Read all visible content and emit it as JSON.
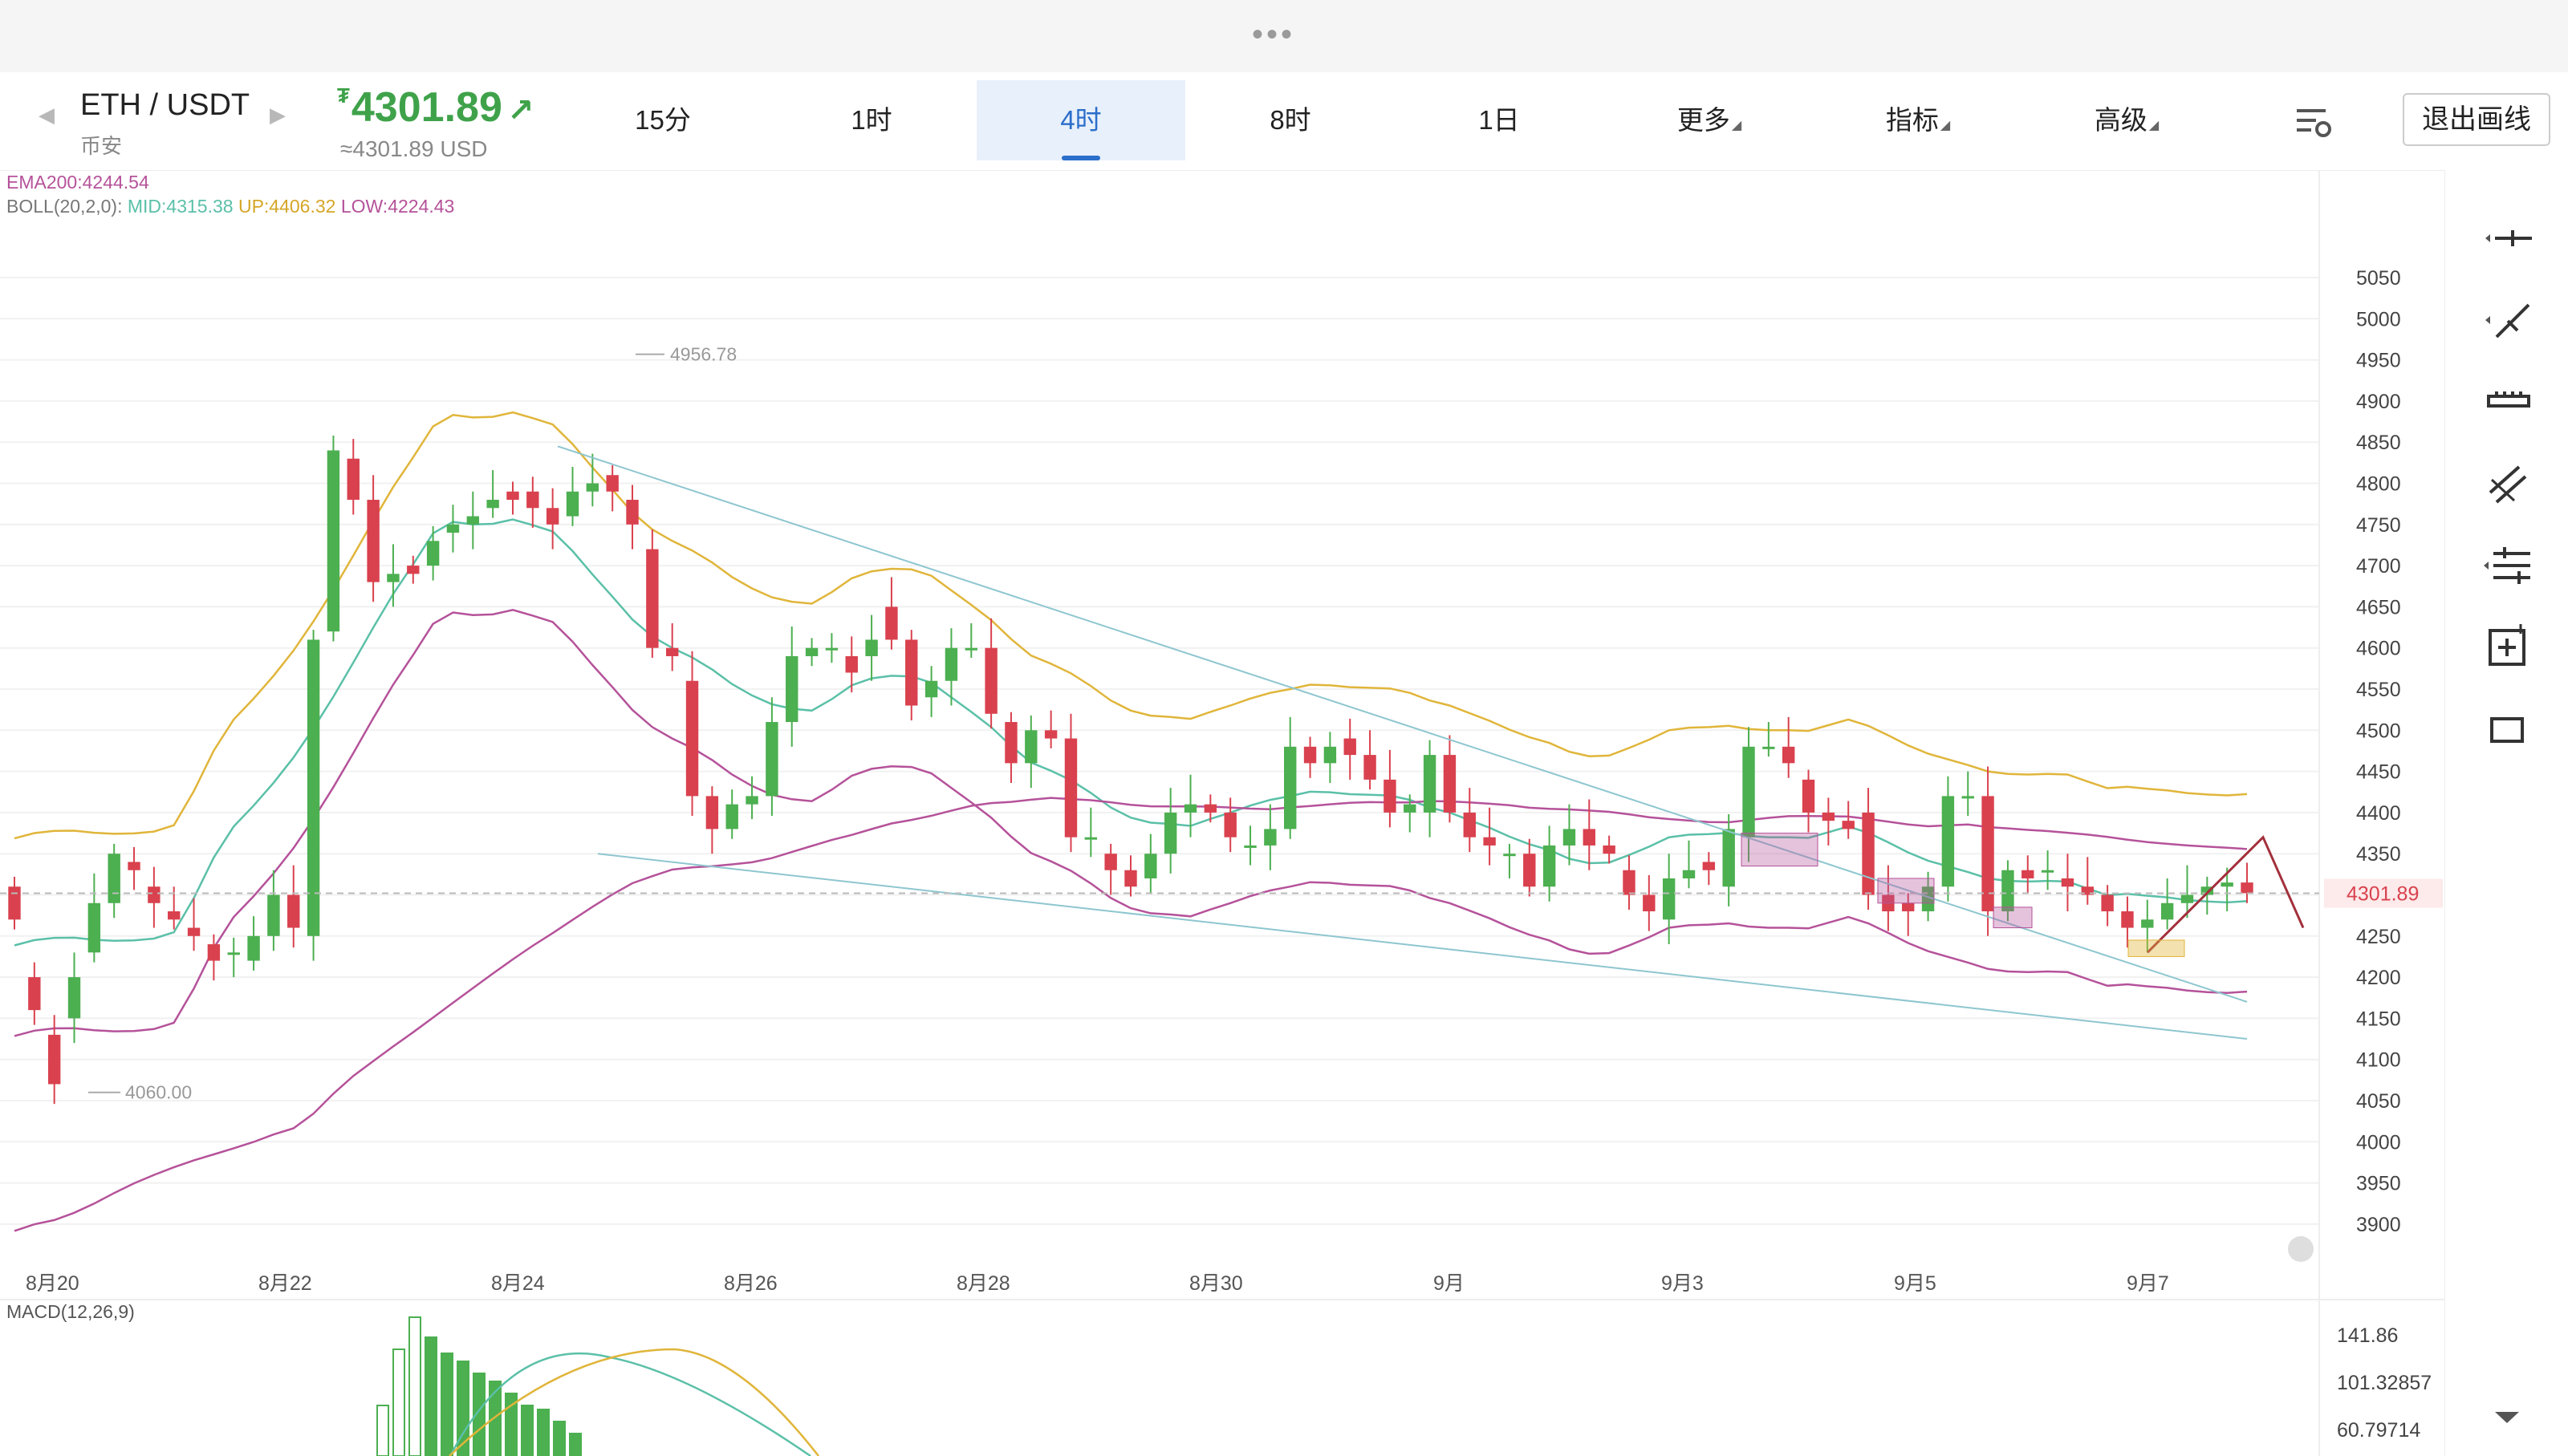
{
  "header": {
    "pair": "ETH / USDT",
    "exchange": "币安",
    "price_symbol": "₮",
    "price": "4301.89",
    "price_usd": "≈4301.89 USD",
    "exit_label": "退出画线"
  },
  "tabs": [
    {
      "label": "15分",
      "active": false
    },
    {
      "label": "1时",
      "active": false
    },
    {
      "label": "4时",
      "active": true
    },
    {
      "label": "8时",
      "active": false
    },
    {
      "label": "1日",
      "active": false
    },
    {
      "label": "更多",
      "active": false
    },
    {
      "label": "指标",
      "active": false
    },
    {
      "label": "高级",
      "active": false
    }
  ],
  "indicators": {
    "ema": "EMA200:4244.54",
    "boll_prefix": "BOLL(20,2,0):",
    "boll_mid": "MID:4315.38",
    "boll_up": "UP:4406.32",
    "boll_low": "LOW:4224.43",
    "macd": "MACD(12,26,9)"
  },
  "colors": {
    "up": "#4caf50",
    "down": "#d9414e",
    "boll_mid": "#5bc0a8",
    "boll_up": "#e0b53a",
    "boll_low": "#b5529a",
    "ema": "#b5529a",
    "accent": "#2b6ecb",
    "price_green": "#3fa24a"
  },
  "chart_data": {
    "type": "candlestick",
    "symbol": "ETH/USDT",
    "interval": "4时",
    "ylim": [
      3860,
      5110
    ],
    "y_ticks": [
      5050,
      5000,
      4950,
      4900,
      4850,
      4800,
      4750,
      4700,
      4650,
      4600,
      4550,
      4500,
      4450,
      4400,
      4350,
      4300,
      4250,
      4200,
      4150,
      4100,
      4050,
      4000,
      3950,
      3900
    ],
    "x_labels": [
      "8月20",
      "8月22",
      "8月24",
      "8月26",
      "8月28",
      "8月30",
      "9月",
      "9月3",
      "9月5",
      "9月7"
    ],
    "current_price": "4301.89",
    "annotations": [
      "4956.78",
      "4060.00"
    ],
    "macd_ticks": [
      "141.86",
      "101.32857",
      "60.79714"
    ],
    "candles": [
      [
        4310,
        4270
      ],
      [
        4200,
        4160
      ],
      [
        4130,
        4070
      ],
      [
        4150,
        4200
      ],
      [
        4230,
        4290
      ],
      [
        4290,
        4350
      ],
      [
        4340,
        4330
      ],
      [
        4310,
        4290
      ],
      [
        4280,
        4270
      ],
      [
        4260,
        4250
      ],
      [
        4240,
        4220
      ],
      [
        4230,
        4230
      ],
      [
        4220,
        4250
      ],
      [
        4250,
        4300
      ],
      [
        4300,
        4260
      ],
      [
        4250,
        4610
      ],
      [
        4620,
        4840
      ],
      [
        4830,
        4780
      ],
      [
        4780,
        4680
      ],
      [
        4680,
        4690
      ],
      [
        4700,
        4690
      ],
      [
        4700,
        4730
      ],
      [
        4740,
        4750
      ],
      [
        4750,
        4760
      ],
      [
        4770,
        4780
      ],
      [
        4790,
        4780
      ],
      [
        4790,
        4770
      ],
      [
        4770,
        4750
      ],
      [
        4760,
        4790
      ],
      [
        4790,
        4800
      ],
      [
        4810,
        4790
      ],
      [
        4780,
        4750
      ],
      [
        4720,
        4600
      ],
      [
        4600,
        4590
      ],
      [
        4560,
        4420
      ],
      [
        4420,
        4380
      ],
      [
        4380,
        4410
      ],
      [
        4410,
        4420
      ],
      [
        4420,
        4510
      ],
      [
        4510,
        4590
      ],
      [
        4590,
        4600
      ],
      [
        4600,
        4600
      ],
      [
        4590,
        4570
      ],
      [
        4590,
        4610
      ],
      [
        4650,
        4610
      ],
      [
        4610,
        4530
      ],
      [
        4540,
        4560
      ],
      [
        4560,
        4600
      ],
      [
        4600,
        4600
      ],
      [
        4600,
        4520
      ],
      [
        4510,
        4460
      ],
      [
        4460,
        4500
      ],
      [
        4500,
        4490
      ],
      [
        4490,
        4370
      ],
      [
        4370,
        4370
      ],
      [
        4350,
        4330
      ],
      [
        4330,
        4310
      ],
      [
        4320,
        4350
      ],
      [
        4350,
        4400
      ],
      [
        4400,
        4410
      ],
      [
        4410,
        4400
      ],
      [
        4400,
        4370
      ],
      [
        4360,
        4360
      ],
      [
        4360,
        4380
      ],
      [
        4380,
        4480
      ],
      [
        4480,
        4460
      ],
      [
        4460,
        4480
      ],
      [
        4490,
        4470
      ],
      [
        4470,
        4440
      ],
      [
        4440,
        4400
      ],
      [
        4400,
        4410
      ],
      [
        4400,
        4470
      ],
      [
        4470,
        4400
      ],
      [
        4400,
        4370
      ],
      [
        4370,
        4360
      ],
      [
        4350,
        4350
      ],
      [
        4350,
        4310
      ],
      [
        4310,
        4360
      ],
      [
        4360,
        4380
      ],
      [
        4380,
        4360
      ],
      [
        4360,
        4350
      ],
      [
        4330,
        4300
      ],
      [
        4300,
        4280
      ],
      [
        4270,
        4320
      ],
      [
        4320,
        4330
      ],
      [
        4340,
        4330
      ],
      [
        4310,
        4380
      ],
      [
        4370,
        4480
      ],
      [
        4480,
        4480
      ],
      [
        4480,
        4460
      ],
      [
        4440,
        4400
      ],
      [
        4400,
        4390
      ],
      [
        4390,
        4380
      ],
      [
        4400,
        4300
      ],
      [
        4300,
        4280
      ],
      [
        4290,
        4280
      ],
      [
        4280,
        4310
      ],
      [
        4310,
        4420
      ],
      [
        4420,
        4420
      ],
      [
        4420,
        4280
      ],
      [
        4280,
        4330
      ],
      [
        4330,
        4320
      ],
      [
        4330,
        4330
      ],
      [
        4320,
        4310
      ],
      [
        4310,
        4300
      ],
      [
        4300,
        4280
      ],
      [
        4280,
        4260
      ],
      [
        4260,
        4270
      ],
      [
        4270,
        4290
      ],
      [
        4290,
        4300
      ],
      [
        4300,
        4310
      ],
      [
        4310,
        4315
      ],
      [
        4315,
        4302
      ]
    ]
  }
}
